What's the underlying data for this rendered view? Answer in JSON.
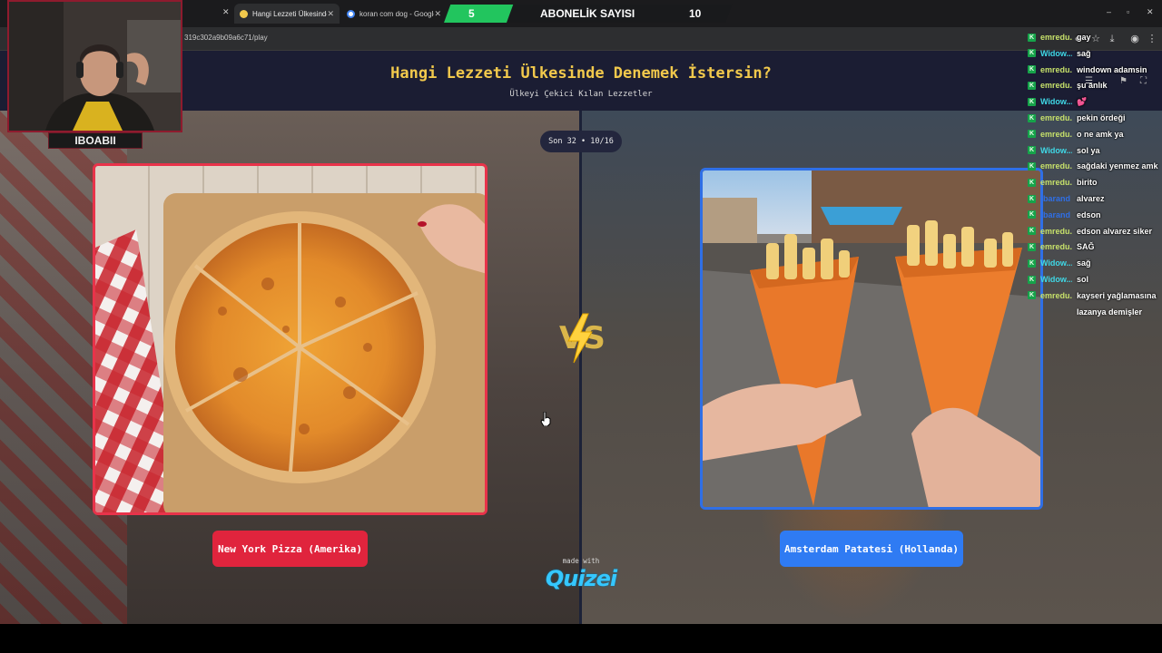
{
  "browser": {
    "tabs": [
      {
        "label": "Hangi Lezzeti Ülkesinde Denem",
        "active": true
      },
      {
        "label": "koran com dog - Google Searc",
        "active": false
      }
    ],
    "url": "319c302a9b09a6c71/play",
    "window_controls": [
      "–",
      "▫",
      "✕"
    ]
  },
  "page": {
    "title": "Hangi Lezzeti Ülkesinde Denemek İstersin?",
    "subtitle": "Ülkeyi Çekici Kılan Lezzetler",
    "round": "Son 32 • 10/16",
    "left_option": {
      "label": "New York Pizza (Amerika)",
      "color": "#e0243d"
    },
    "right_option": {
      "label": "Amsterdam Patatesi (Hollanda)",
      "color": "#2f7bf3"
    },
    "made_with": "made with",
    "brand": "Quizei"
  },
  "stream_overlay": {
    "streamer": "IBOABII",
    "subscriber_goal": {
      "label": "ABONELİK SAYISI",
      "current": "5",
      "target": "10",
      "progress": 0.1
    },
    "chat": [
      {
        "user": "emredu...",
        "message": "gay",
        "color": "#c6e06a"
      },
      {
        "user": "Widow...",
        "message": "sağ",
        "color": "#3fd8e6"
      },
      {
        "user": "emredu...",
        "message": "windown adamsin",
        "color": "#c6e06a"
      },
      {
        "user": "emredu...",
        "message": "şu anlık",
        "color": "#c6e06a"
      },
      {
        "user": "Widow...",
        "message": "💕",
        "color": "#3fd8e6"
      },
      {
        "user": "emredu...",
        "message": "pekin ördeği",
        "color": "#c6e06a"
      },
      {
        "user": "emredu...",
        "message": "o ne amk ya",
        "color": "#c6e06a"
      },
      {
        "user": "Widow...",
        "message": "sol ya",
        "color": "#3fd8e6"
      },
      {
        "user": "emredu...",
        "message": "sağdaki yenmez amk",
        "color": "#c6e06a"
      },
      {
        "user": "emredu...",
        "message": "birito",
        "color": "#c6e06a"
      },
      {
        "user": "fbarand",
        "message": "alvarez",
        "color": "#2f6fe6"
      },
      {
        "user": "fbarand",
        "message": "edson",
        "color": "#2f6fe6"
      },
      {
        "user": "emredu...",
        "message": "edson alvarez siker",
        "color": "#c6e06a"
      },
      {
        "user": "emredu...",
        "message": "SAĞ",
        "color": "#c6e06a"
      },
      {
        "user": "Widow...",
        "message": "sağ",
        "color": "#3fd8e6"
      },
      {
        "user": "Widow...",
        "message": "sol",
        "color": "#3fd8e6"
      },
      {
        "user": "emredu...",
        "message": "kayseri yağlamasına",
        "color": "#c6e06a"
      }
    ],
    "chat_continuation": "lazanya demişler"
  }
}
